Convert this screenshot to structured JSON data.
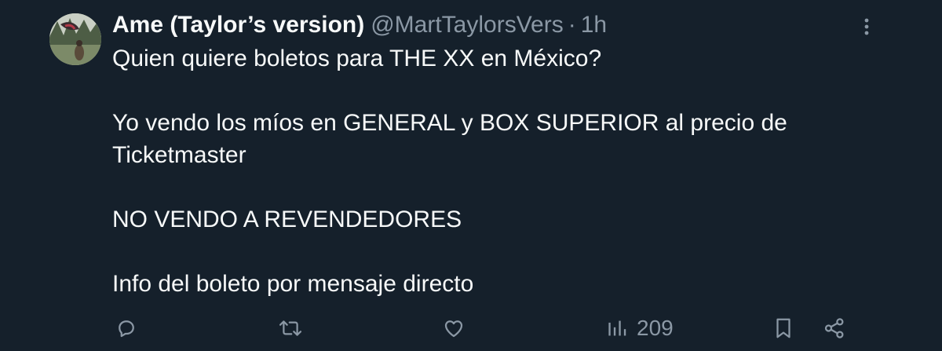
{
  "tweet": {
    "author": {
      "display_name": "Ame (Taylor’s version)",
      "handle": "@MartTaylorsVers",
      "separator": "·",
      "time": "1h"
    },
    "text_lines": [
      "Quien quiere boletos para THE XX en México?",
      "Yo vendo los míos en GENERAL y BOX SUPERIOR al precio de",
      "Ticketmaster",
      "NO VENDO A REVENDEDORES",
      "Info del boleto por mensaje directo"
    ],
    "metrics": {
      "views": "209"
    },
    "icons": {
      "more": "more-vertical-icon",
      "reply": "reply-icon",
      "retweet": "retweet-icon",
      "like": "heart-icon",
      "views": "views-bar-chart-icon",
      "bookmark": "bookmark-icon",
      "share": "share-icon"
    }
  },
  "colors": {
    "background": "#15202b",
    "primary_text": "#f7f9f9",
    "secondary_text": "#8b98a5"
  }
}
